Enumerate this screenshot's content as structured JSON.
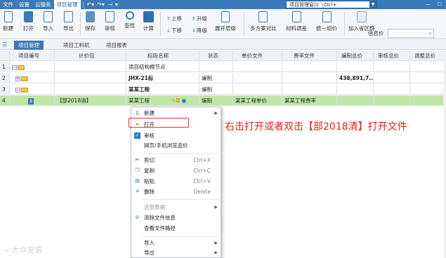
{
  "titlebar": {
    "menus": [
      "文件",
      "设置",
      "云服务",
      "项目管理"
    ],
    "window_box": "项目管理窗口（Ctrl+`"
  },
  "ribbon": {
    "buttons": [
      "新建",
      "打开",
      "导入",
      "导出",
      "保存",
      "审核",
      "查找",
      "计算",
      "展开层级",
      "多方案对比",
      "材料调差",
      "统一组价",
      "加入省区群"
    ],
    "small": [
      "上移",
      "升级",
      "下移",
      "降级"
    ],
    "search_label": "信息价"
  },
  "tabs": [
    "项目管理",
    "项目工料机",
    "项目报表"
  ],
  "columns": [
    "项目编号",
    "计价包",
    "标段名称",
    "状态",
    "单价文件",
    "费率文件",
    "编制总价",
    "审核总价",
    "调整总价"
  ],
  "rows": [
    {
      "num": "1",
      "name": "项目结构根节点",
      "status": "",
      "unit": "",
      "rate": "",
      "total": ""
    },
    {
      "num": "2",
      "name": "JHX-21标",
      "status": "编制",
      "unit": "",
      "rate": "",
      "total": "438,891,7..."
    },
    {
      "num": "3",
      "name": "某某工程",
      "status": "编制",
      "unit": "",
      "rate": "",
      "total": ""
    },
    {
      "num": "4",
      "pkg": "【部2018清】",
      "name": "某某工程",
      "status": "编制",
      "unit": "某某工程单价",
      "rate": "某某工程费率",
      "total": ""
    }
  ],
  "menu": [
    {
      "label": "新建",
      "shortcut": "",
      "arrow": true,
      "icon": "new-file-icon"
    },
    {
      "label": "打开",
      "shortcut": "",
      "icon": "open-folder-icon"
    },
    {
      "label": "审核",
      "shortcut": "",
      "icon": "audit-icon"
    },
    {
      "label": "网页/手机浏览造价",
      "shortcut": ""
    },
    {
      "label": "剪切",
      "shortcut": "Ctrl+X",
      "icon": "scissors-icon"
    },
    {
      "label": "复制",
      "shortcut": "Ctrl+C",
      "icon": "copy-icon"
    },
    {
      "label": "粘贴",
      "shortcut": "Ctrl+V",
      "icon": "paste-icon"
    },
    {
      "label": "删除",
      "shortcut": "Delete",
      "icon": "delete-icon"
    },
    {
      "label": "还原数据",
      "shortcut": "",
      "arrow": true,
      "disabled": true
    },
    {
      "label": "清除文件信息",
      "shortcut": "",
      "icon": "clear-icon"
    },
    {
      "label": "查看文件路径",
      "shortcut": ""
    },
    {
      "label": "导入",
      "shortcut": "",
      "arrow": true
    },
    {
      "label": "导出",
      "shortcut": "",
      "arrow": true
    }
  ],
  "annotation": "右击打开或者双击【部2018清】打开文件",
  "watermark": "大众安装",
  "colors": {
    "accent": "#3b79b8",
    "selected_row": "#bfe6a8",
    "annotation": "#e3211b"
  }
}
